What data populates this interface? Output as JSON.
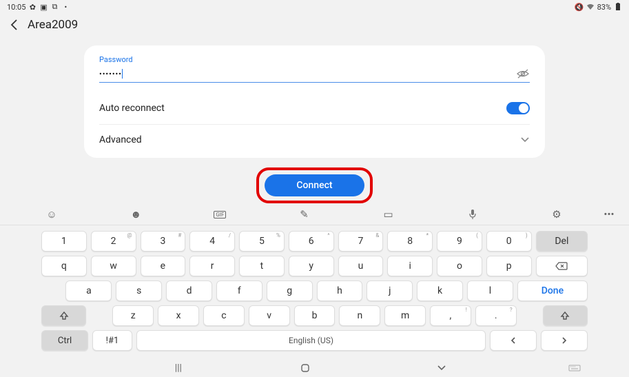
{
  "status": {
    "time": "10:05",
    "battery": "83%"
  },
  "header": {
    "title": "Area2009"
  },
  "form": {
    "password_label": "Password",
    "password_value": "•••••••",
    "auto_reconnect_label": "Auto reconnect",
    "auto_reconnect": true,
    "advanced_label": "Advanced",
    "connect_label": "Connect"
  },
  "keyboard": {
    "row1": [
      {
        "k": "1",
        "s": ""
      },
      {
        "k": "2",
        "s": "@"
      },
      {
        "k": "3",
        "s": "#"
      },
      {
        "k": "4",
        "s": "/"
      },
      {
        "k": "5",
        "s": "%"
      },
      {
        "k": "6",
        "s": "^"
      },
      {
        "k": "7",
        "s": "&"
      },
      {
        "k": "8",
        "s": "*"
      },
      {
        "k": "9",
        "s": "("
      },
      {
        "k": "0",
        "s": ")"
      }
    ],
    "del_label": "Del",
    "row2": [
      "q",
      "w",
      "e",
      "r",
      "t",
      "y",
      "u",
      "i",
      "o",
      "p"
    ],
    "row3": [
      "a",
      "s",
      "d",
      "f",
      "g",
      "h",
      "j",
      "k",
      "l"
    ],
    "done_label": "Done",
    "row4": [
      {
        "k": "z",
        "s": ""
      },
      {
        "k": "x",
        "s": ""
      },
      {
        "k": "c",
        "s": ""
      },
      {
        "k": "v",
        "s": ""
      },
      {
        "k": "b",
        "s": ""
      },
      {
        "k": "n",
        "s": ""
      },
      {
        "k": "m",
        "s": ""
      },
      {
        "k": ",",
        "s": "!"
      },
      {
        "k": ".",
        "s": "?"
      }
    ],
    "ctrl_label": "Ctrl",
    "sym_label": "!#1",
    "space_label": "English (US)"
  }
}
